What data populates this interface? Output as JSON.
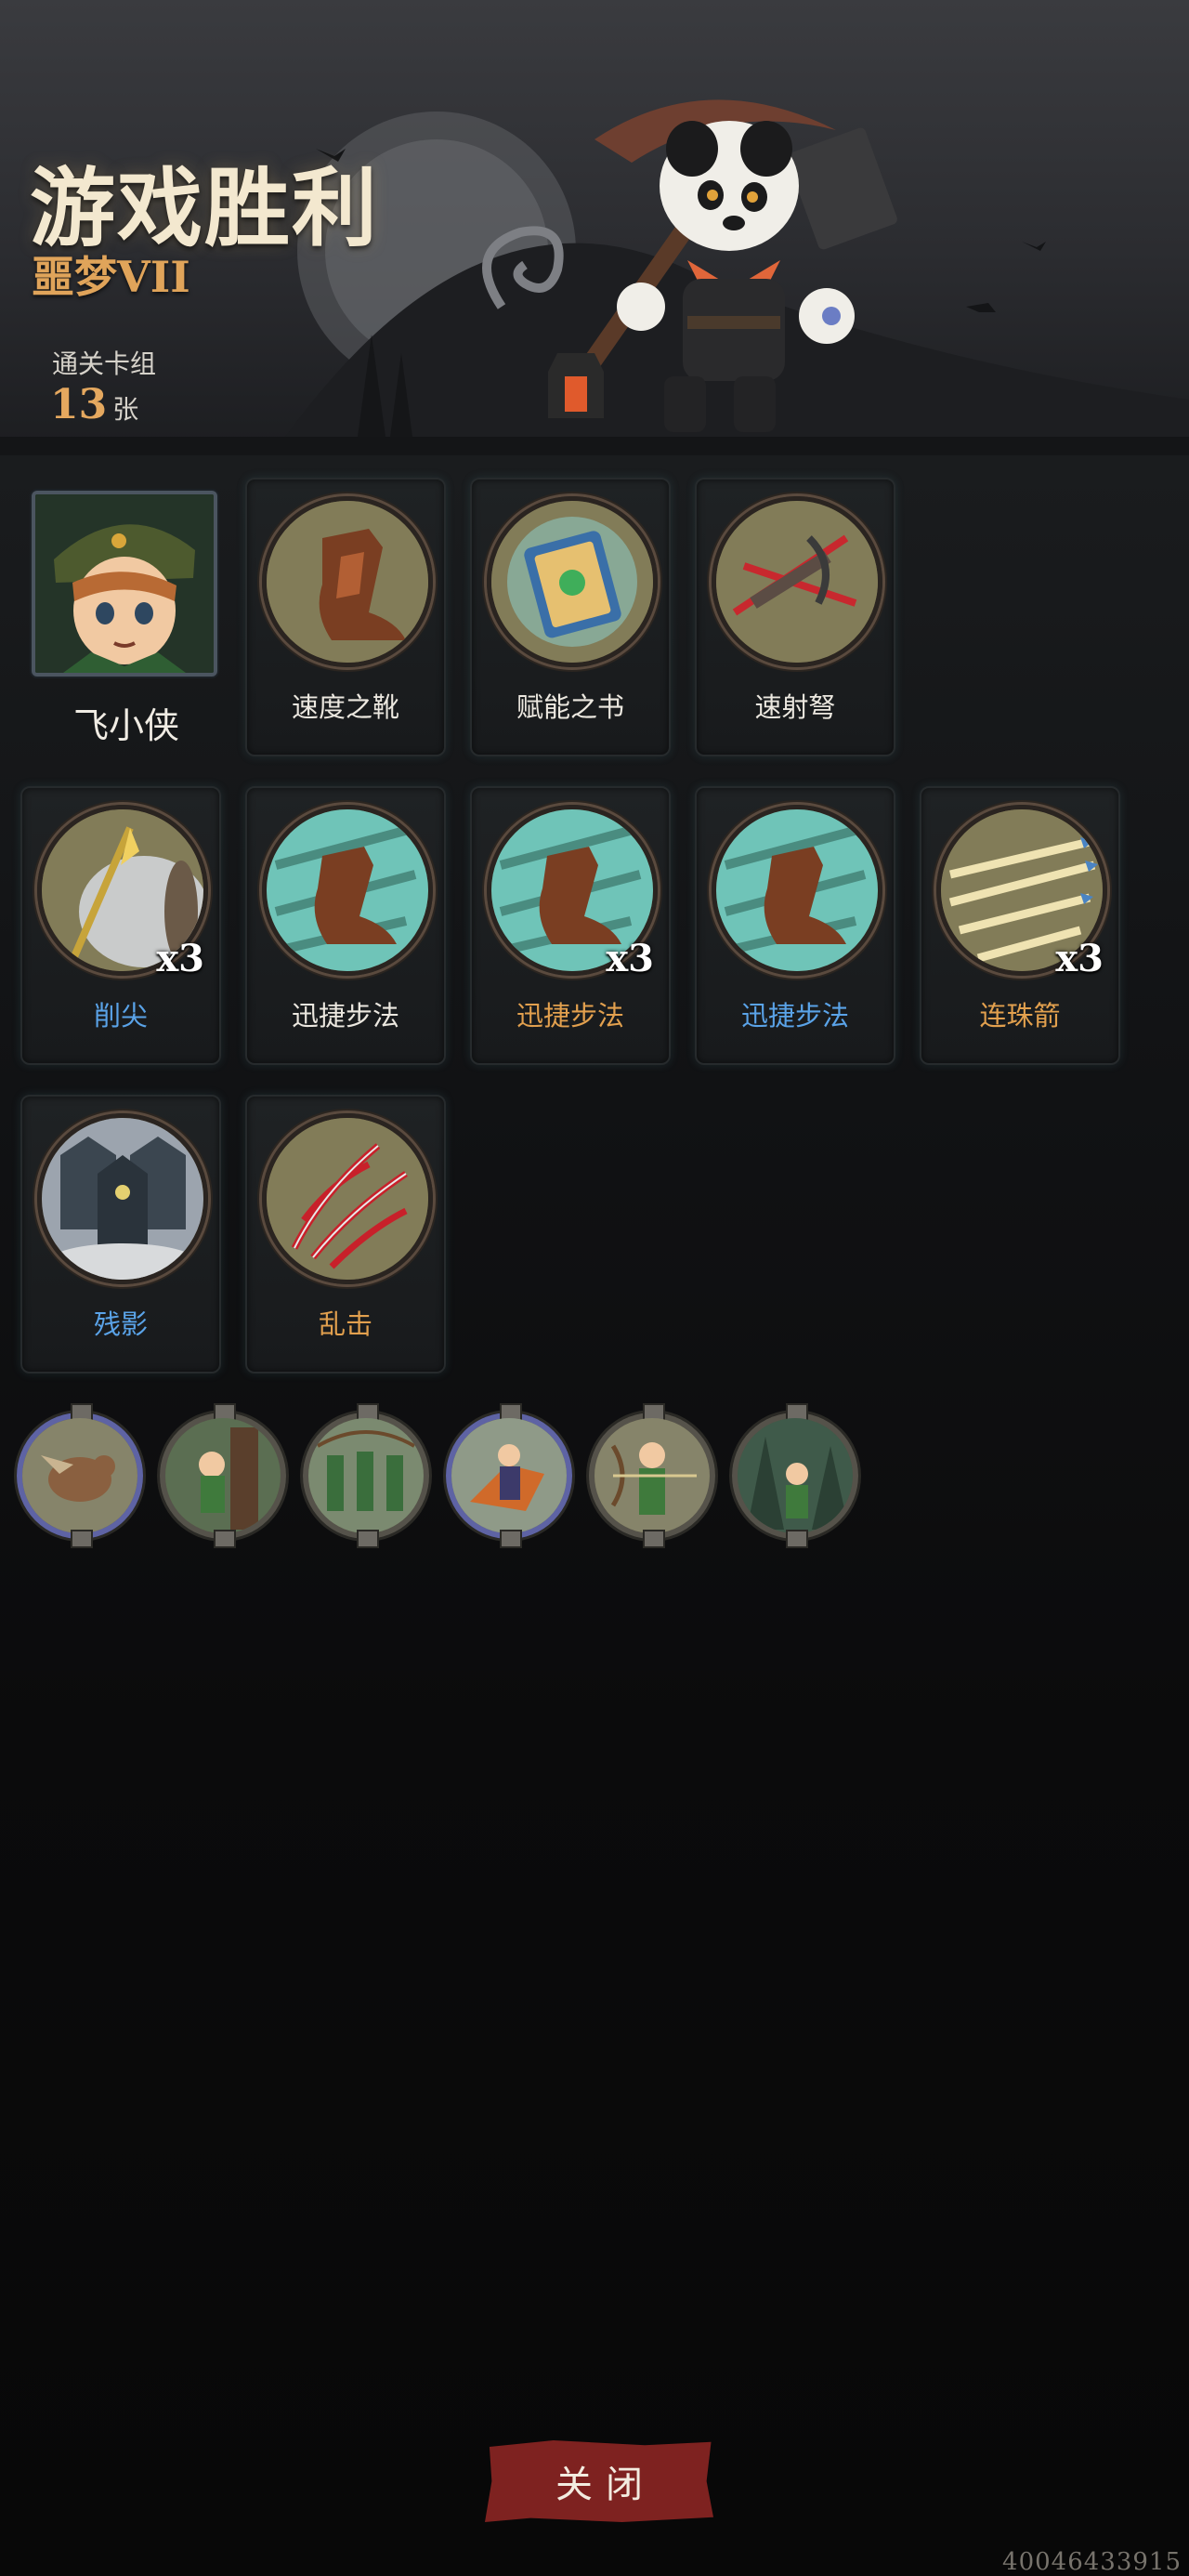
{
  "header": {
    "title": "游戏胜利",
    "difficulty": "噩梦VII",
    "deck_label": "通关卡组",
    "deck_count": "13",
    "deck_unit": "张"
  },
  "hero": {
    "name": "飞小侠"
  },
  "cards": [
    {
      "label": "速度之靴",
      "multiplier": "",
      "color": "white",
      "icon": "boot-icon"
    },
    {
      "label": "赋能之书",
      "multiplier": "",
      "color": "white",
      "icon": "book-icon"
    },
    {
      "label": "速射弩",
      "multiplier": "",
      "color": "white",
      "icon": "crossbow-icon"
    },
    {
      "label": "削尖",
      "multiplier": "x3",
      "color": "blue",
      "icon": "sharpen-icon"
    },
    {
      "label": "迅捷步法",
      "multiplier": "",
      "color": "white",
      "icon": "swift-step-icon"
    },
    {
      "label": "迅捷步法",
      "multiplier": "x3",
      "color": "gold",
      "icon": "swift-step-icon"
    },
    {
      "label": "迅捷步法",
      "multiplier": "",
      "color": "blue",
      "icon": "swift-step-icon"
    },
    {
      "label": "连珠箭",
      "multiplier": "x3",
      "color": "gold",
      "icon": "arrow-barrage-icon"
    },
    {
      "label": "残影",
      "multiplier": "",
      "color": "blue",
      "icon": "afterimage-icon"
    },
    {
      "label": "乱击",
      "multiplier": "",
      "color": "gold",
      "icon": "flurry-icon"
    }
  ],
  "relics": [
    {
      "icon": "bird-relic-icon",
      "border": "blue"
    },
    {
      "icon": "forest-archer-relic-icon",
      "border": "gray"
    },
    {
      "icon": "archer-squad-relic-icon",
      "border": "gray"
    },
    {
      "icon": "fox-relic-icon",
      "border": "blue"
    },
    {
      "icon": "aiming-archer-relic-icon",
      "border": "gray"
    },
    {
      "icon": "forest-scout-relic-icon",
      "border": "gray"
    }
  ],
  "footer": {
    "close_label": "关闭",
    "game_id": "40046433915"
  },
  "colors": {
    "accent_gold": "#e2a04e",
    "accent_blue": "#5aa3e8",
    "button_red": "#7e2220"
  }
}
